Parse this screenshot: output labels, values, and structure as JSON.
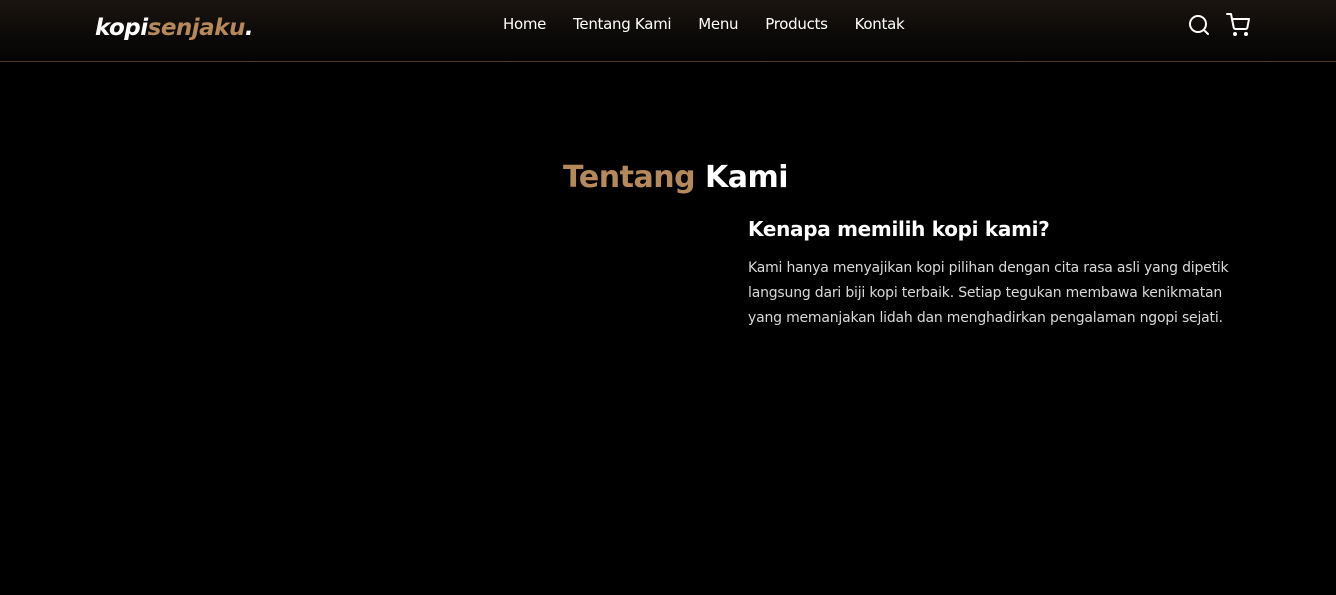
{
  "brand": {
    "part1": "kopi",
    "part2": "senjaku",
    "suffix": "."
  },
  "nav": {
    "items": [
      "Home",
      "Tentang Kami",
      "Menu",
      "Products",
      "Kontak"
    ]
  },
  "icons": {
    "search": "search-icon",
    "cart": "shopping-cart-icon"
  },
  "about": {
    "title_accent": "Tentang",
    "title_rest": "Kami",
    "heading": "Kenapa memilih kopi kami?",
    "body": "Kami hanya menyajikan kopi pilihan dengan cita rasa asli yang dipetik langsung dari biji kopi terbaik. Setiap tegukan membawa kenikmatan yang memanjakan lidah dan menghadirkan pengalaman ngopi sejati."
  },
  "colors": {
    "accent": "#b6895b",
    "background": "#000000",
    "text": "#ffffff"
  }
}
